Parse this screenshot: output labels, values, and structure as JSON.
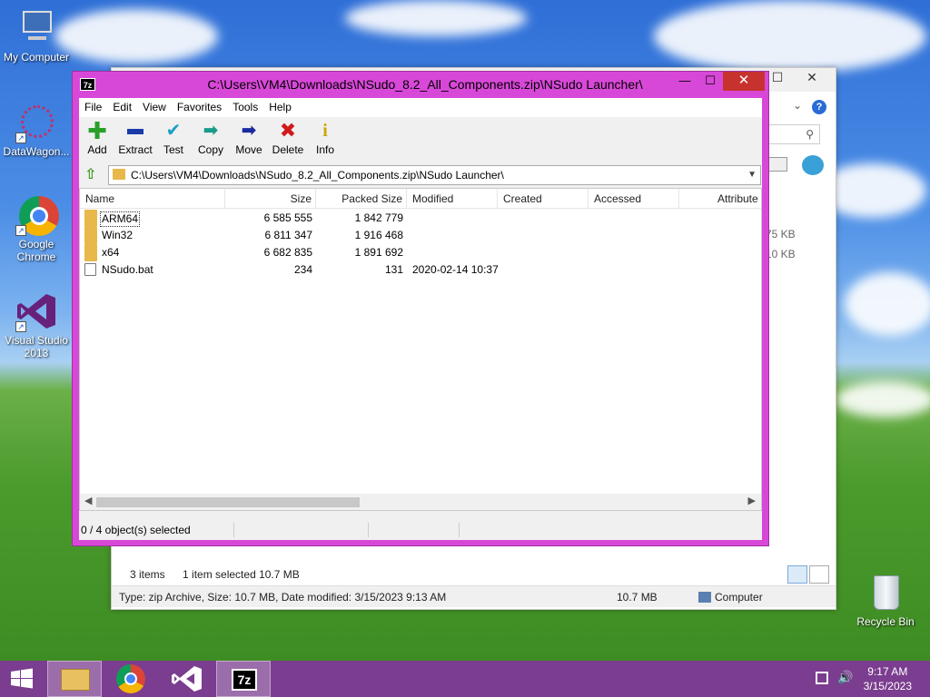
{
  "desktop": {
    "icons": [
      {
        "label": "My Computer",
        "icon": "computer-icon"
      },
      {
        "label": "DataWagon...",
        "icon": "datawagon-icon"
      },
      {
        "label": "Google Chrome",
        "icon": "chrome-icon"
      },
      {
        "label": "Visual Studio 2013",
        "icon": "visual-studio-icon"
      },
      {
        "label": "Recycle Bin",
        "icon": "recycle-bin-icon"
      }
    ]
  },
  "explorer_bg": {
    "sizes": [
      "75 KB",
      "10 KB"
    ],
    "items_count": "3 items",
    "selected": "1 item selected  10.7 MB",
    "details": "Type: zip Archive, Size: 10.7 MB, Date modified: 3/15/2023 9:13 AM",
    "size": "10.7 MB",
    "location": "Computer"
  },
  "zip": {
    "app_icon": "7z",
    "title": "C:\\Users\\VM4\\Downloads\\NSudo_8.2_All_Components.zip\\NSudo Launcher\\",
    "menu": [
      "File",
      "Edit",
      "View",
      "Favorites",
      "Tools",
      "Help"
    ],
    "toolbar": [
      {
        "label": "Add",
        "icon": "plus-icon",
        "color": "#2aa02a"
      },
      {
        "label": "Extract",
        "icon": "minus-icon",
        "color": "#1a3aa8"
      },
      {
        "label": "Test",
        "icon": "check-icon",
        "color": "#1aa0c8"
      },
      {
        "label": "Copy",
        "icon": "double-arrow-icon",
        "color": "#1a9a8a"
      },
      {
        "label": "Move",
        "icon": "arrow-right-icon",
        "color": "#1a2aa0"
      },
      {
        "label": "Delete",
        "icon": "x-icon",
        "color": "#d01a1a"
      },
      {
        "label": "Info",
        "icon": "info-icon",
        "color": "#c8a800"
      }
    ],
    "address": "C:\\Users\\VM4\\Downloads\\NSudo_8.2_All_Components.zip\\NSudo Launcher\\",
    "columns": [
      "Name",
      "Size",
      "Packed Size",
      "Modified",
      "Created",
      "Accessed",
      "Attribute"
    ],
    "rows": [
      {
        "name": "ARM64",
        "size": "6 585 555",
        "packed": "1 842 779",
        "modified": "",
        "type": "folder"
      },
      {
        "name": "Win32",
        "size": "6 811 347",
        "packed": "1 916 468",
        "modified": "",
        "type": "folder"
      },
      {
        "name": "x64",
        "size": "6 682 835",
        "packed": "1 891 692",
        "modified": "",
        "type": "folder"
      },
      {
        "name": "NSudo.bat",
        "size": "234",
        "packed": "131",
        "modified": "2020-02-14 10:37",
        "type": "file"
      }
    ],
    "status": "0 / 4 object(s) selected"
  },
  "taskbar": {
    "time": "9:17 AM",
    "date": "3/15/2023",
    "apps": [
      "windows-start-icon",
      "file-explorer-icon",
      "chrome-icon",
      "visual-studio-icon",
      "7zip-icon"
    ],
    "accent": "#7b3d8f"
  }
}
